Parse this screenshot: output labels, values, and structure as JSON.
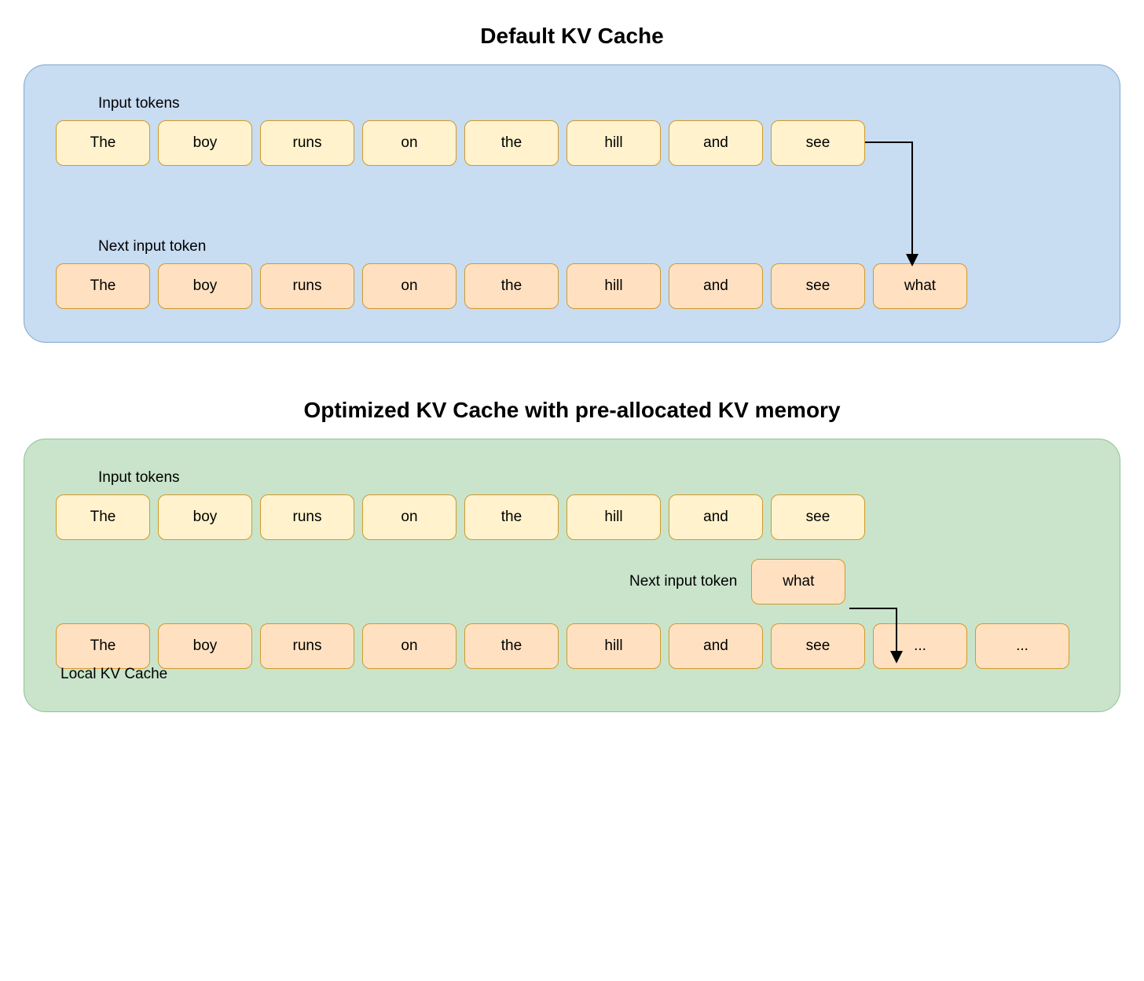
{
  "titles": {
    "default": "Default KV Cache",
    "optimized": "Optimized KV Cache with pre-allocated KV memory"
  },
  "labels": {
    "input_tokens": "Input tokens",
    "next_input_token": "Next input token",
    "local_kv_cache": "Local KV Cache"
  },
  "tokens": {
    "sentence": [
      "The",
      "boy",
      "runs",
      "on",
      "the",
      "hill",
      "and",
      "see"
    ],
    "next": "what",
    "placeholder": "..."
  },
  "colors": {
    "panel_blue_bg": "#c8dcf2",
    "panel_green_bg": "#c9e4cb",
    "token_yellow_bg": "#fff2cc",
    "token_orange_bg": "#ffe1c2",
    "token_border": "#d09a2a"
  }
}
